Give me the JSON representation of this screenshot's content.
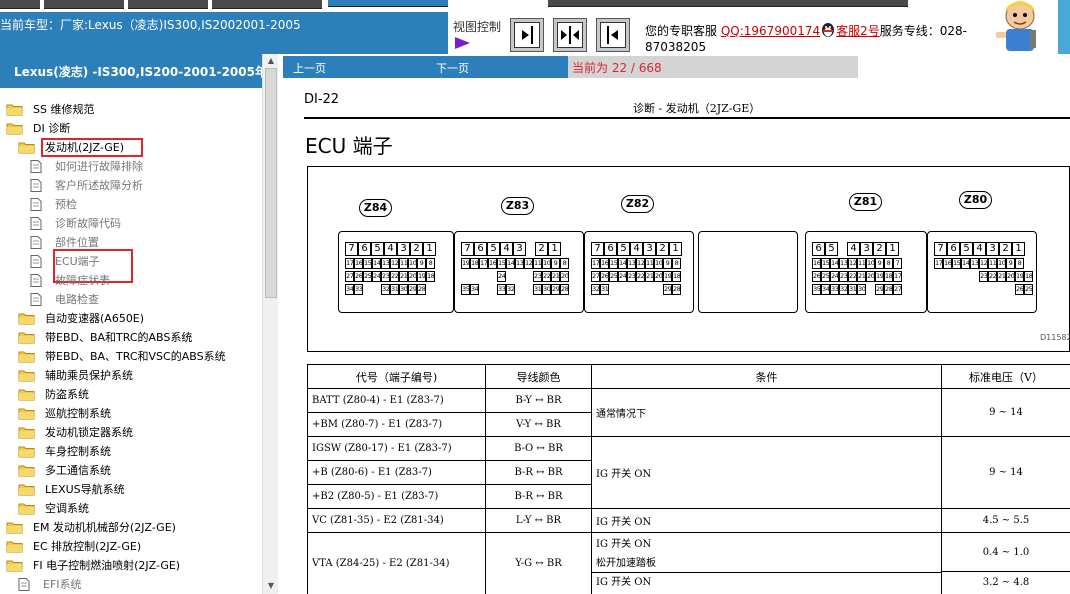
{
  "header": {
    "vehicle_title": "当前车型：厂家:Lexus（凌志)IS300,IS2002001-2005",
    "view_control_label": "视图控制",
    "service": {
      "prefix": "您的专职客服",
      "qq_link": "QQ:1967900174",
      "kefu_link": "客服2号",
      "hotline_label": "服务专线：028-",
      "hotline_number": "87038205"
    }
  },
  "sidebar": {
    "title": "Lexus(凌志) -IS300,IS200-2001-2005年",
    "tree": [
      {
        "label": "SS 维修规范",
        "kind": "folder"
      },
      {
        "label": "DI 诊断",
        "kind": "folder"
      },
      {
        "label": "发动机(2JZ-GE)",
        "kind": "folder",
        "highlight": true
      },
      {
        "label": "如何进行故障排除",
        "kind": "doc"
      },
      {
        "label": "客户所述故障分析",
        "kind": "doc"
      },
      {
        "label": "预检",
        "kind": "doc"
      },
      {
        "label": "诊断故障代码",
        "kind": "doc"
      },
      {
        "label": "部件位置",
        "kind": "doc"
      },
      {
        "label": "ECU端子",
        "kind": "doc",
        "highlight": true
      },
      {
        "label": "故障症状表",
        "kind": "doc"
      },
      {
        "label": "电路检查",
        "kind": "doc"
      },
      {
        "label": "自动变速器(A650E)",
        "kind": "folder"
      },
      {
        "label": "带EBD、BA和TRC的ABS系统",
        "kind": "folder"
      },
      {
        "label": "带EBD、BA、TRC和VSC的ABS系统",
        "kind": "folder"
      },
      {
        "label": "辅助乘员保护系统",
        "kind": "folder"
      },
      {
        "label": "防盗系统",
        "kind": "folder"
      },
      {
        "label": "巡航控制系统",
        "kind": "folder"
      },
      {
        "label": "发动机锁定器系统",
        "kind": "folder"
      },
      {
        "label": "车身控制系统",
        "kind": "folder"
      },
      {
        "label": "多工通信系统",
        "kind": "folder"
      },
      {
        "label": "LEXUS导航系统",
        "kind": "folder"
      },
      {
        "label": "空调系统",
        "kind": "folder"
      },
      {
        "label": "EM 发动机机械部分(2JZ-GE)",
        "kind": "folder"
      },
      {
        "label": "EC 排放控制(2JZ-GE)",
        "kind": "folder"
      },
      {
        "label": "FI 电子控制燃油喷射(2JZ-GE)",
        "kind": "folder"
      },
      {
        "label": "EFI系统",
        "kind": "doc"
      }
    ]
  },
  "pagenav": {
    "prev_label": "上一页",
    "next_label": "下一页",
    "page_counter": "当前为 22 / 668"
  },
  "document": {
    "page_code": "DI-22",
    "header_center": "诊断 - 发动机（2JZ-GE）",
    "heading": "ECU 端子",
    "figure_code": "D11582",
    "connectors": [
      {
        "label": "Z84",
        "rows": [
          [
            "7",
            "6",
            "5",
            "4",
            "3",
            "2",
            "1"
          ],
          [
            "17",
            "16",
            "15",
            "14",
            "13",
            "12",
            "11",
            "10",
            "9",
            "8"
          ],
          [
            "27",
            "26",
            "25",
            "24",
            "23",
            "22",
            "21",
            "20",
            "19",
            "18"
          ],
          [
            "34",
            "33",
            "",
            "",
            "32",
            "31",
            "30",
            "29",
            "28"
          ]
        ]
      },
      {
        "label": "Z83",
        "rows": [
          [
            "7",
            "6",
            "5",
            "4",
            "3",
            "",
            "2",
            "1"
          ],
          [
            "19",
            "18",
            "17",
            "16",
            "15",
            "14",
            "13",
            "12",
            "11",
            "10",
            "9",
            "8"
          ],
          [
            "",
            "",
            "",
            "",
            "24",
            "",
            "",
            "",
            "23",
            "22",
            "21",
            "20"
          ],
          [
            "35",
            "34",
            "",
            "",
            "33",
            "32",
            "",
            "",
            "31",
            "30",
            "29",
            "28"
          ]
        ]
      },
      {
        "label": "Z82",
        "rows": [
          [
            "7",
            "6",
            "5",
            "4",
            "3",
            "2",
            "1"
          ],
          [
            "17",
            "16",
            "15",
            "14",
            "13",
            "12",
            "11",
            "10",
            "9",
            "8"
          ],
          [
            "27",
            "26",
            "25",
            "24",
            "23",
            "22",
            "21",
            "20",
            "19",
            "18"
          ],
          [
            "32",
            "31",
            "",
            "",
            "",
            "",
            "",
            "",
            "29",
            "28"
          ]
        ]
      },
      {
        "label": "Z81",
        "rows": [
          [
            "6",
            "5",
            "",
            "4",
            "3",
            "2",
            "1"
          ],
          [
            "16",
            "15",
            "14",
            "13",
            "12",
            "11",
            "10",
            "9",
            "8",
            "7"
          ],
          [
            "26",
            "25",
            "24",
            "23",
            "22",
            "21",
            "20",
            "19",
            "18",
            "17"
          ],
          [
            "35",
            "34",
            "33",
            "32",
            "31",
            "30",
            "",
            "29",
            "28",
            "27"
          ]
        ]
      },
      {
        "label": "Z80",
        "rows": [
          [
            "7",
            "6",
            "5",
            "4",
            "3",
            "2",
            "1"
          ],
          [
            "17",
            "16",
            "15",
            "14",
            "13",
            "12",
            "11",
            "10",
            "9",
            "8"
          ],
          [
            "",
            "",
            "",
            "",
            "",
            "23",
            "22",
            "21",
            "20",
            "19",
            "18"
          ],
          [
            "",
            "",
            "",
            "",
            "",
            "",
            "",
            "",
            "",
            "26",
            "25"
          ]
        ]
      }
    ],
    "table": {
      "headers": [
        "代号（端子编号)",
        "导线颜色",
        "条件",
        "标准电压（V）"
      ],
      "rows": [
        {
          "signal": "BATT (Z80-4) - E1 (Z83-7)",
          "wire": "B-Y ↔ BR"
        },
        {
          "signal": "+BM (Z80-7) - E1 (Z83-7)",
          "wire": "V-Y ↔ BR"
        },
        {
          "signal": "IGSW (Z80-17) - E1 (Z83-7)",
          "wire": "B-O ↔ BR"
        },
        {
          "signal": "+B (Z80-6) - E1 (Z83-7)",
          "wire": "B-R ↔ BR"
        },
        {
          "signal": "+B2 (Z80-5) - E1 (Z83-7)",
          "wire": "B-R ↔ BR"
        },
        {
          "signal": "VC (Z81-35) - E2 (Z81-34)",
          "wire": "L-Y ↔ BR"
        },
        {
          "signal": "VTA (Z84-25) - E2 (Z81-34)",
          "wire": "Y-G ↔ BR"
        }
      ],
      "cond_normal": "通常情况下",
      "cond_ig_on": "IG 开关 ON",
      "cond_ig_on_2": "IG 开关 ON",
      "cond_vta_1a": "IG 开关 ON",
      "cond_vta_1b": "松开加速踏板",
      "cond_vta_2a": "IG 开关 ON",
      "std_normal": "9 ~ 14",
      "std_ig_on": "9 ~ 14",
      "std_vc": "4.5 ~ 5.5",
      "std_vta_1": "0.4 ~ 1.0",
      "std_vta_2": "3.2 ~ 4.8"
    }
  }
}
